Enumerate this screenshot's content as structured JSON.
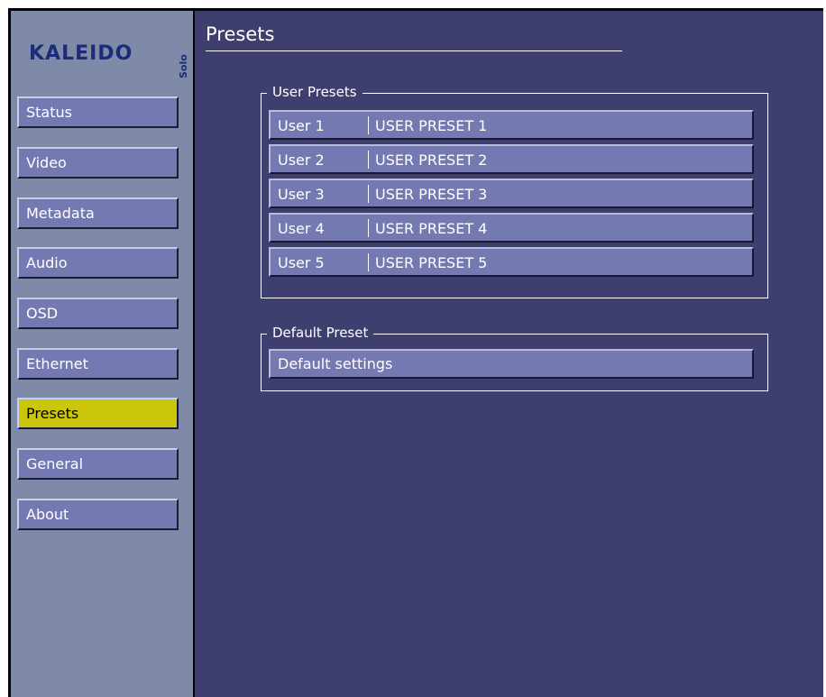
{
  "brand": {
    "name": "KALEIDO",
    "edition": "Solo"
  },
  "sidebar": {
    "items": [
      {
        "label": "Status",
        "active": false
      },
      {
        "label": "Video",
        "active": false
      },
      {
        "label": "Metadata",
        "active": false
      },
      {
        "label": "Audio",
        "active": false
      },
      {
        "label": "OSD",
        "active": false
      },
      {
        "label": "Ethernet",
        "active": false
      },
      {
        "label": "Presets",
        "active": true
      },
      {
        "label": "General",
        "active": false
      },
      {
        "label": "About",
        "active": false
      }
    ]
  },
  "page": {
    "title": "Presets"
  },
  "user_presets": {
    "label": "User Presets",
    "rows": [
      {
        "slot": "User 1",
        "name": "USER PRESET 1"
      },
      {
        "slot": "User 2",
        "name": "USER PRESET 2"
      },
      {
        "slot": "User 3",
        "name": "USER PRESET 3"
      },
      {
        "slot": "User 4",
        "name": "USER PRESET 4"
      },
      {
        "slot": "User 5",
        "name": "USER PRESET 5"
      }
    ]
  },
  "default_preset": {
    "label": "Default Preset",
    "button_label": "Default settings"
  },
  "colors": {
    "sidebar_bg": "#7f8aa9",
    "main_bg": "#3f3f6f",
    "button_bg": "#7479b2",
    "active_bg": "#c9c60b",
    "brand": "#1c2b7a"
  }
}
